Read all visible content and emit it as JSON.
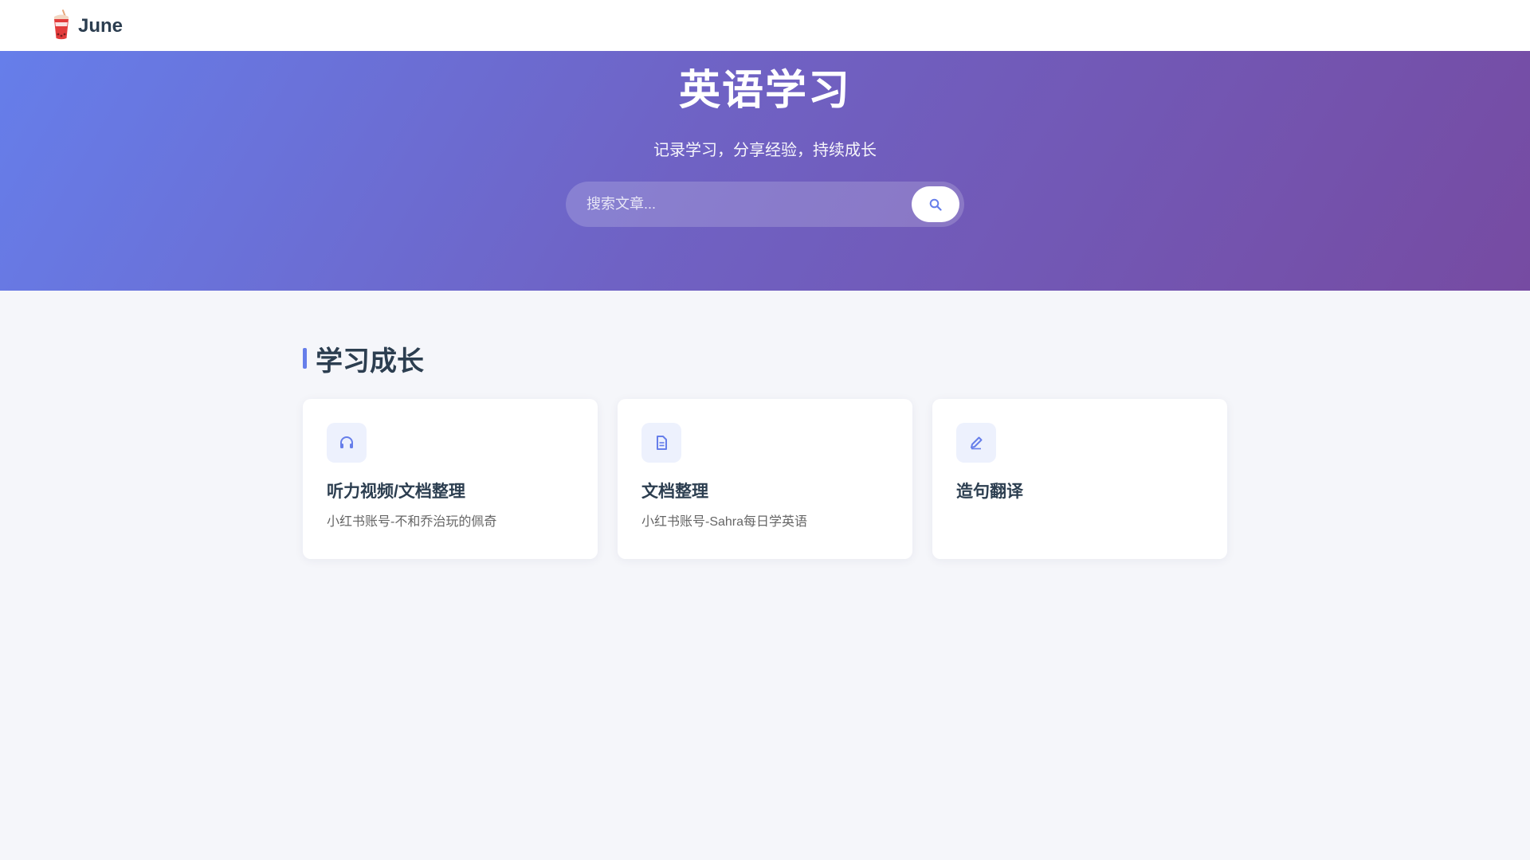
{
  "header": {
    "brand_name": "June",
    "brand_icon": "bubble-tea-icon"
  },
  "hero": {
    "title": "英语学习",
    "subtitle": "记录学习，分享经验，持续成长",
    "search": {
      "placeholder": "搜索文章...",
      "value": "",
      "button_icon": "search-icon"
    }
  },
  "section": {
    "title": "学习成长",
    "cards": [
      {
        "icon": "headphones-icon",
        "title": "听力视频/文档整理",
        "desc": "小红书账号-不和乔治玩的佩奇"
      },
      {
        "icon": "document-icon",
        "title": "文档整理",
        "desc": "小红书账号-Sahra每日学英语"
      },
      {
        "icon": "pen-icon",
        "title": "造句翻译",
        "desc": ""
      }
    ]
  },
  "colors": {
    "accent": "#667eea",
    "gradient_start": "#667eea",
    "gradient_end": "#764ba2",
    "page_bg": "#f5f6fa",
    "heading": "#2c3e50"
  }
}
